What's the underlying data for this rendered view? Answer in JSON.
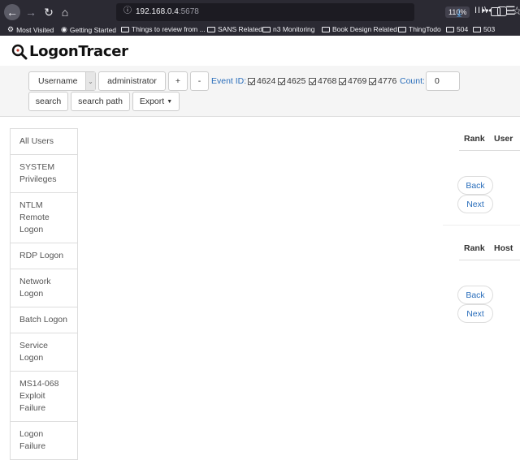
{
  "browser": {
    "url_host": "192.168.0.4",
    "url_port": ":5678",
    "zoom": "110%",
    "bookmarks": [
      {
        "label": "Most Visited",
        "icon": "gear-icon"
      },
      {
        "label": "Getting Started",
        "icon": "globe-icon"
      },
      {
        "label": "Things to review from ...",
        "icon": "folder-icon"
      },
      {
        "label": "SANS Related",
        "icon": "folder-icon"
      },
      {
        "label": "n3 Monitoring",
        "icon": "folder-icon"
      },
      {
        "label": "Book Design Related",
        "icon": "folder-icon"
      },
      {
        "label": "ThingTodo",
        "icon": "folder-icon"
      },
      {
        "label": "504",
        "icon": "folder-icon"
      },
      {
        "label": "503",
        "icon": "folder-icon"
      }
    ]
  },
  "app": {
    "title": "LogonTracer"
  },
  "filters": {
    "type_selected": "Username",
    "query_value": "administrator",
    "plus_label": "+",
    "minus_label": "-",
    "event_id_label": "Event ID:",
    "events": [
      "4624",
      "4625",
      "4768",
      "4769",
      "4776"
    ],
    "count_label": "Count:",
    "count_value": "0",
    "search_label": "search",
    "search_path_label": "search path",
    "export_label": "Export"
  },
  "sidebar": {
    "items": [
      "All Users",
      "SYSTEM Privileges",
      "NTLM Remote Logon",
      "RDP Logon",
      "Network Logon",
      "Batch Logon",
      "Service Logon",
      "MS14-068 Exploit Failure",
      "Logon Failure"
    ]
  },
  "rank_panels": {
    "users": {
      "rank_header": "Rank",
      "col_header": "User",
      "back_label": "Back",
      "next_label": "Next"
    },
    "hosts": {
      "rank_header": "Rank",
      "col_header": "Host",
      "back_label": "Back",
      "next_label": "Next"
    }
  }
}
